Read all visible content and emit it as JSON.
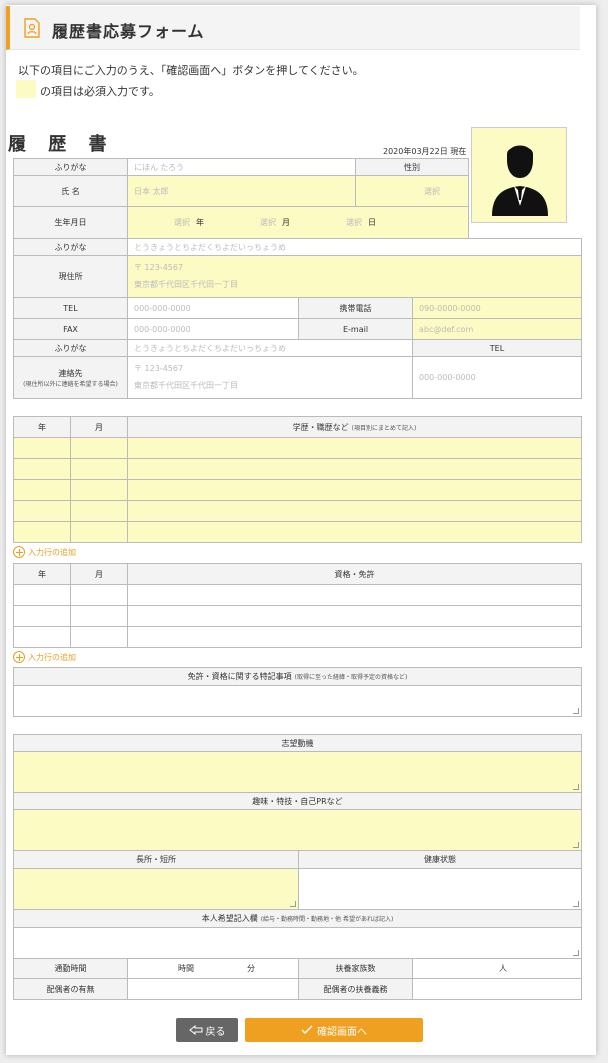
{
  "header": {
    "title": "履歴書応募フォーム",
    "icon": "document-user-icon",
    "accent": "#f0a020"
  },
  "intro": {
    "line1": "以下の項目にご入力のうえ、「確認画面へ」ボタンを押してください。",
    "line2": "の項目は必須入力です。",
    "required_color": "#fdfbc4"
  },
  "resume": {
    "title": "履 歴 書",
    "date": "2020年03月22日 現在"
  },
  "labels": {
    "furigana": "ふりがな",
    "gender": "性別",
    "name": "氏 名",
    "birth": "生年月日",
    "address": "現住所",
    "tel": "TEL",
    "mobile": "携帯電話",
    "fax": "FAX",
    "email": "E-mail",
    "contact": "連絡先",
    "contact_note": "(現住所以外に連絡を希望する場合)"
  },
  "values": {
    "name_kana": "にほん たろう",
    "name": "日本 太郎",
    "gender": "選択",
    "birth_year": "選択",
    "birth_year_unit": "年",
    "birth_month": "選択",
    "birth_month_unit": "月",
    "birth_day": "選択",
    "birth_day_unit": "日",
    "addr_kana": "とうきょうとちよだくちよだいっちょうめ",
    "postal": "〒 123-4567",
    "address": "東京都千代田区千代田一丁目",
    "tel": "000-000-0000",
    "mobile": "090-0000-0000",
    "fax": "000-000-0000",
    "email": "abc@def.com",
    "contact_kana": "とうきょうとちよだくちよだいっちょうめ",
    "contact_postal": "〒 123-4567",
    "contact_address": "東京都千代田区千代田一丁目",
    "contact_tel": "000-000-0000"
  },
  "history": {
    "col_year": "年",
    "col_month": "月",
    "col_desc": "学歴・職歴など",
    "col_desc_note": "(項目別にまとめて記入)"
  },
  "add_row": "入力行の追加",
  "license": {
    "col_year": "年",
    "col_month": "月",
    "col_desc": "資格・免許"
  },
  "special": {
    "title": "免許・資格に関する特記事項",
    "note": "(取得に至った経緯・取得予定の資格など)"
  },
  "motive": {
    "title": "志望動機"
  },
  "hobby": {
    "title": "趣味・特技・自己PRなど"
  },
  "strength": {
    "title": "長所・短所"
  },
  "health": {
    "title": "健康状態"
  },
  "wish": {
    "title": "本人希望記入欄",
    "note": "(給与・勤務時間・勤務地・他 希望があれば記入)"
  },
  "bottom": {
    "commute": "通勤時間",
    "hour": "時間",
    "minute": "分",
    "dependents": "扶養家族数",
    "person": "人",
    "spouse": "配偶者の有無",
    "spouse_support": "配偶者の扶養義務"
  },
  "buttons": {
    "back": "戻る",
    "back_icon": "arrow-left-icon",
    "confirm": "確認画面へ",
    "confirm_icon": "check-icon"
  }
}
